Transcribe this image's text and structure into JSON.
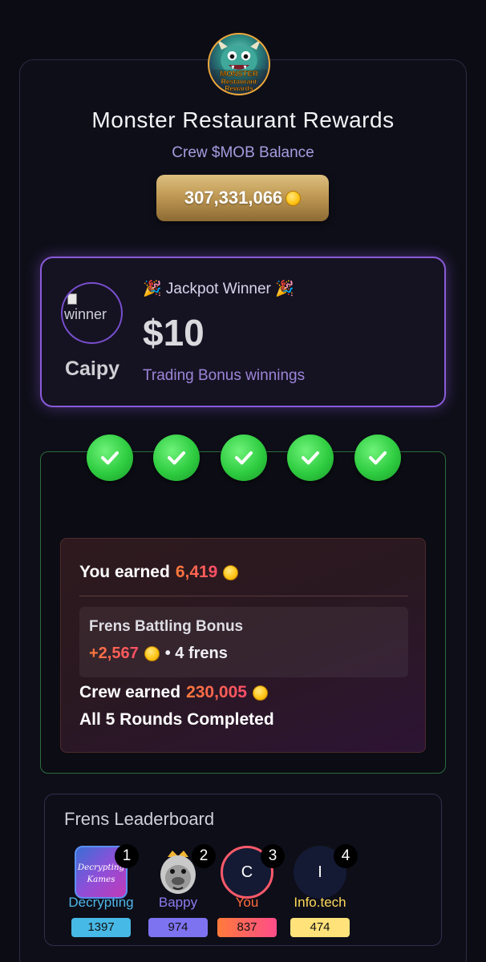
{
  "app": {
    "title": "Monster Restaurant Rewards",
    "logo_text": [
      "MONSTER",
      "Restaurant",
      "Rewards"
    ],
    "balance_label": "Crew $MOB Balance",
    "balance_value": "307,331,066"
  },
  "jackpot": {
    "title": "🎉 Jackpot Winner 🎉",
    "amount": "$10",
    "subtitle": "Trading Bonus winnings",
    "winner_name": "Caipy",
    "avatar_alt": "winner"
  },
  "rounds": {
    "completed_count": 5,
    "you_earned_label": "You earned",
    "you_earned_value": "6,419",
    "frens_bonus_title": "Frens Battling Bonus",
    "frens_bonus_value": "+2,567",
    "frens_count_text": "• 4 frens",
    "crew_earned_label": "Crew earned",
    "crew_earned_value": "230,005",
    "status_text": "All 5 Rounds Completed"
  },
  "leaderboard": {
    "title": "Frens Leaderboard",
    "entries": [
      {
        "rank": "1",
        "name": "Decrypting",
        "score": "1397",
        "avatar": "image",
        "avatar_text": "Decrypting Kames",
        "name_color": "#4fb6e8",
        "score_bg": "#47b9e6"
      },
      {
        "rank": "2",
        "name": "Bappy",
        "score": "974",
        "avatar": "image",
        "avatar_text": "",
        "name_color": "#8a7cf0",
        "score_bg": "#7d73f0"
      },
      {
        "rank": "3",
        "name": "You",
        "score": "837",
        "avatar": "letter",
        "avatar_text": "C",
        "name_color": "#ff6b3d",
        "score_bg": "#ff7a3a"
      },
      {
        "rank": "4",
        "name": "Info.tech",
        "score": "474",
        "avatar": "letter",
        "avatar_text": "I",
        "name_color": "#ffd95a",
        "score_bg": "#ffe27a"
      }
    ]
  },
  "colors": {
    "accent_purple": "#8a5ad9",
    "success_green": "#2ecc40",
    "gold": "#c09a55",
    "earn_orange": "#ff6b3d"
  }
}
